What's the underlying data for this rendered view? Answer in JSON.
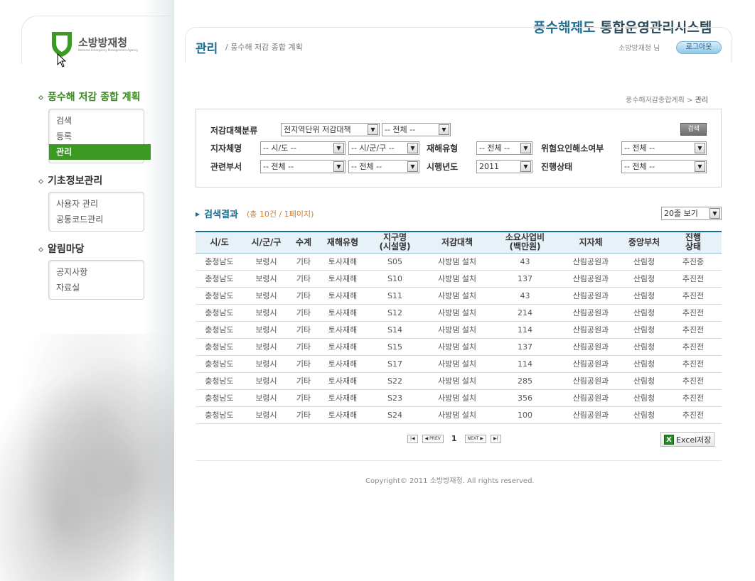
{
  "app": {
    "title_a": "풍수해제도",
    "title_b": "통합운영관리시스템",
    "logo_ko": "소방방재청",
    "logo_en": "National Emergency Management Agency"
  },
  "header": {
    "page_title": "관리",
    "page_sub": "/   풍수해 저감 종합 계획",
    "user_label": "소방방재청 님",
    "logout_label": "로그아웃"
  },
  "breadcrumb": {
    "parent": "풍수해저감종합계획",
    "sep": " > ",
    "current": "관리"
  },
  "sidebar": {
    "sections": [
      {
        "title": "풍수해 저감 종합 계획",
        "items": [
          {
            "label": "검색"
          },
          {
            "label": "등록"
          },
          {
            "label": "관리"
          }
        ]
      },
      {
        "title": "기초정보관리",
        "items": [
          {
            "label": "사용자 관리"
          },
          {
            "label": "공통코드관리"
          }
        ]
      },
      {
        "title": "알림마당",
        "items": [
          {
            "label": "공지사항"
          },
          {
            "label": "자료실"
          }
        ]
      }
    ]
  },
  "search": {
    "labels": {
      "category": "저감대책분류",
      "local_gov": "지자체명",
      "disaster_type": "재해유형",
      "risk_resolved": "위험요인해소여부",
      "dept": "관련부서",
      "year": "시행년도",
      "status": "진행상태"
    },
    "values": {
      "category1": "전지역단위 저감대책",
      "category2": "-- 전체 --",
      "sido": "-- 시/도 --",
      "sigungu": "-- 시/군/구 --",
      "disaster_type": "-- 전체 --",
      "risk_resolved": "-- 전체 --",
      "dept1": "-- 전체 --",
      "dept2": "-- 전체 --",
      "year": "2011",
      "status": "-- 전체 --"
    },
    "button": "검색"
  },
  "results": {
    "title": "검색결과",
    "count": "(총 10건 / 1페이지)",
    "rows_per_page": "20줄 보기",
    "columns": [
      "시/도",
      "시/군/구",
      "수계",
      "재해유형",
      "지구명\n(시설명)",
      "저감대책",
      "소요사업비\n(백만원)",
      "지자체",
      "중앙부처",
      "진행\n상태"
    ],
    "rows": [
      [
        "충청남도",
        "보령시",
        "기타",
        "토사재해",
        "S05",
        "사방댐 설치",
        "43",
        "산림공원과",
        "산림청",
        "추진중"
      ],
      [
        "충청남도",
        "보령시",
        "기타",
        "토사재해",
        "S10",
        "사방댐 설치",
        "137",
        "산림공원과",
        "산림청",
        "추진전"
      ],
      [
        "충청남도",
        "보령시",
        "기타",
        "토사재해",
        "S11",
        "사방댐 설치",
        "43",
        "산림공원과",
        "산림청",
        "추진전"
      ],
      [
        "충청남도",
        "보령시",
        "기타",
        "토사재해",
        "S12",
        "사방댐 설치",
        "214",
        "산림공원과",
        "산림청",
        "추진전"
      ],
      [
        "충청남도",
        "보령시",
        "기타",
        "토사재해",
        "S14",
        "사방댐 설치",
        "114",
        "산림공원과",
        "산림청",
        "추진전"
      ],
      [
        "충청남도",
        "보령시",
        "기타",
        "토사재해",
        "S15",
        "사방댐 설치",
        "137",
        "산림공원과",
        "산림청",
        "추진전"
      ],
      [
        "충청남도",
        "보령시",
        "기타",
        "토사재해",
        "S17",
        "사방댐 설치",
        "114",
        "산림공원과",
        "산림청",
        "추진전"
      ],
      [
        "충청남도",
        "보령시",
        "기타",
        "토사재해",
        "S22",
        "사방댐 설치",
        "285",
        "산림공원과",
        "산림청",
        "추진전"
      ],
      [
        "충청남도",
        "보령시",
        "기타",
        "토사재해",
        "S23",
        "사방댐 설치",
        "356",
        "산림공원과",
        "산림청",
        "추진전"
      ],
      [
        "충청남도",
        "보령시",
        "기타",
        "토사재해",
        "S24",
        "사방댐 설치",
        "100",
        "산림공원과",
        "산림청",
        "추진전"
      ]
    ]
  },
  "pager": {
    "first": "|◀",
    "prev": "◀ PREV",
    "current": "1",
    "next": "NEXT ▶",
    "last": "▶|"
  },
  "excel_button": "Excel저장",
  "footer": {
    "copyright": "Copyright© 2011 소방방재청. All rights reserved."
  },
  "colors": {
    "accent_blue": "#1b6c92",
    "menu_green": "#3a9a22",
    "count_orange": "#e07b1a"
  }
}
